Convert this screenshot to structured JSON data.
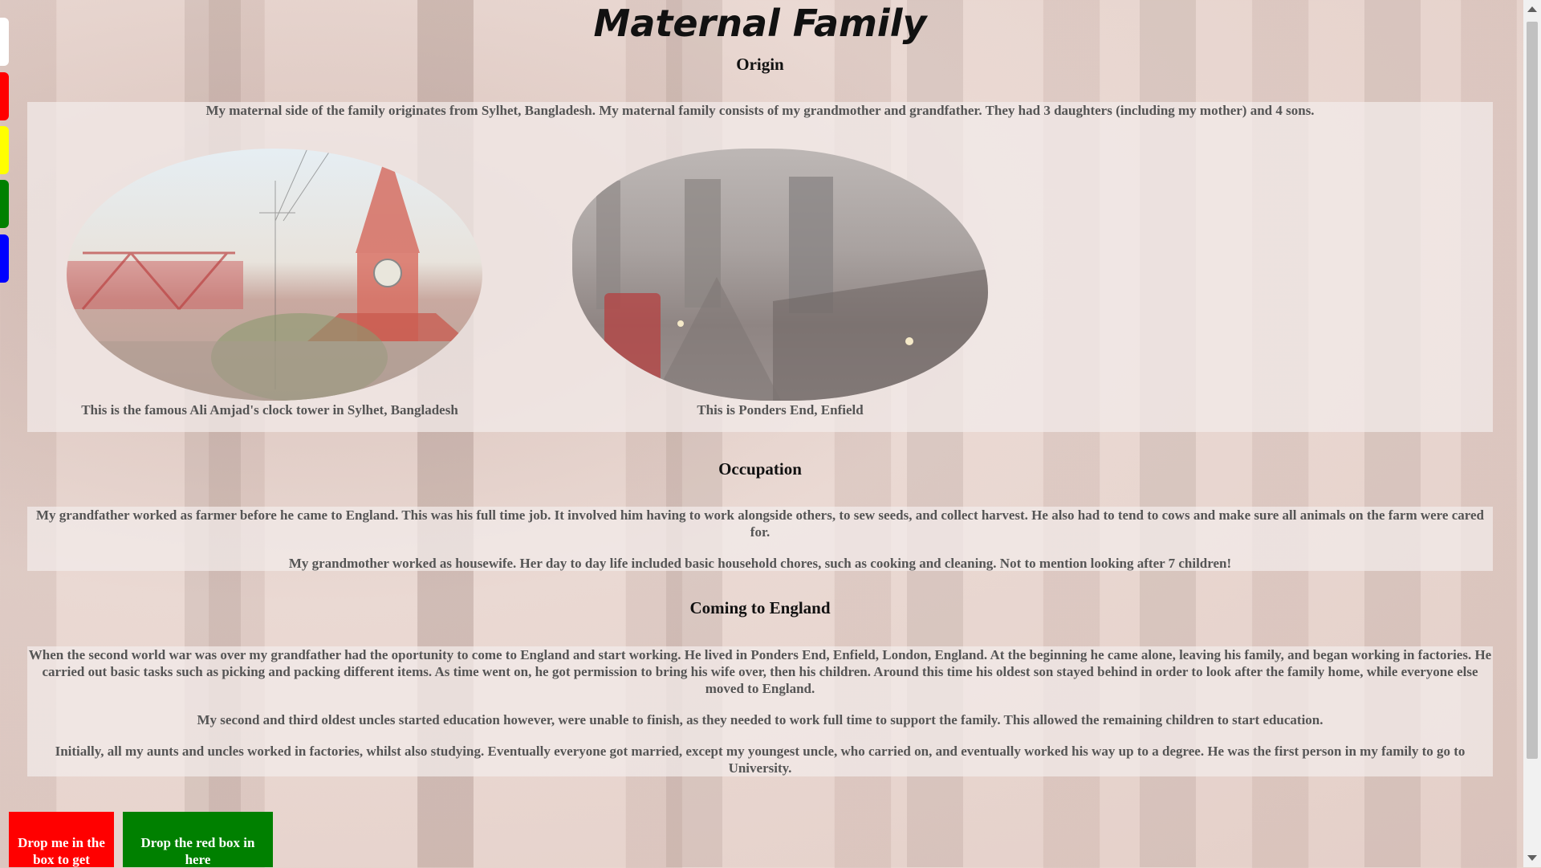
{
  "title": "Maternal Family",
  "sections": {
    "origin": {
      "heading": "Origin",
      "text": "My maternal side of the family originates from Sylhet, Bangladesh. My maternal family consists of my grandmother and grandfather. They had 3 daughters (including my mother) and 4 sons.",
      "captions": [
        "This is the famous Ali Amjad's clock tower in Sylhet, Bangladesh",
        "This is Ponders End, Enfield"
      ]
    },
    "occupation": {
      "heading": "Occupation",
      "paragraphs": [
        "My grandfather worked as farmer before he came to England. This was his full time job. It involved him having to work alongside others, to sew seeds, and collect harvest. He also had to tend to cows and make sure all animals on the farm were cared for.",
        "My grandmother worked as housewife. Her day to day life included basic household chores, such as cooking and cleaning. Not to mention looking after 7 children!"
      ]
    },
    "coming": {
      "heading": "Coming to England",
      "paragraphs": [
        "When the second world war was over my grandfather had the oportunity to come to England and start working. He lived in Ponders End, Enfield, London, England. At the beginning he came alone, leaving his family, and began working in factories. He carried out basic tasks such as picking and packing different items. As time went on, he got permission to bring his wife over, then his children. Around this time his oldest son stayed behind in order to look after the family home, while everyone else moved to England.",
        "My second and third oldest uncles started education however, were unable to finish, as they needed to work full time to support the family. This allowed the remaining children to start education.",
        "Initially, all my aunts and uncles worked in factories, whilst also studying. Eventually everyone got married, except my youngest uncle, who carried on, and eventually worked his way up to a degree. He was the first person in my family to go to University."
      ]
    }
  },
  "drag": {
    "red_label": "Drop me in the box to get",
    "green_label": "Drop the red box in here"
  },
  "colors": {
    "tabs": [
      "#ffffff",
      "#ff0000",
      "#ffff00",
      "#008000",
      "#0000ff"
    ],
    "red_box": "#ff0000",
    "green_box": "#008000"
  }
}
